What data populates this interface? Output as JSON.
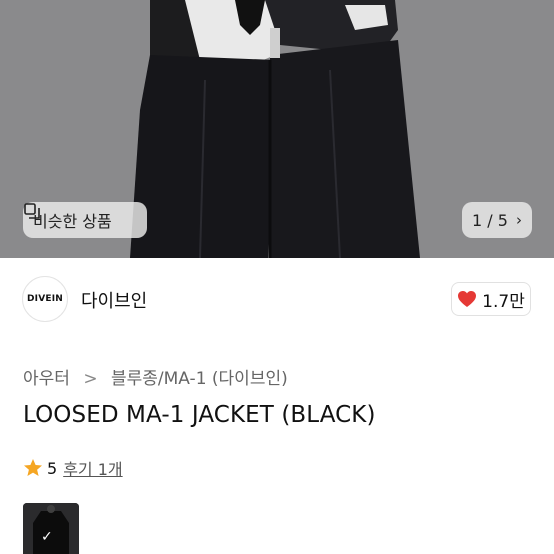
{
  "hero": {
    "similar_label": "비슷한 상품",
    "pager": {
      "text": "1 / 5",
      "current": 1,
      "total": 5
    }
  },
  "seller": {
    "logo_text": "DIVEIN",
    "name": "다이브인",
    "likes": "1.7만"
  },
  "product": {
    "breadcrumb": [
      "아우터",
      "블루종/MA-1 (다이브인)"
    ],
    "breadcrumb_separator": ">",
    "title": "LOOSED MA-1 JACKET (BLACK)",
    "rating": "5",
    "review_link": "후기 1개"
  },
  "thumbnails": [
    {
      "selected": true
    }
  ],
  "colors": {
    "heart": "#e53935",
    "star": "#f5a623",
    "chip_bg": "#ebebeb"
  }
}
